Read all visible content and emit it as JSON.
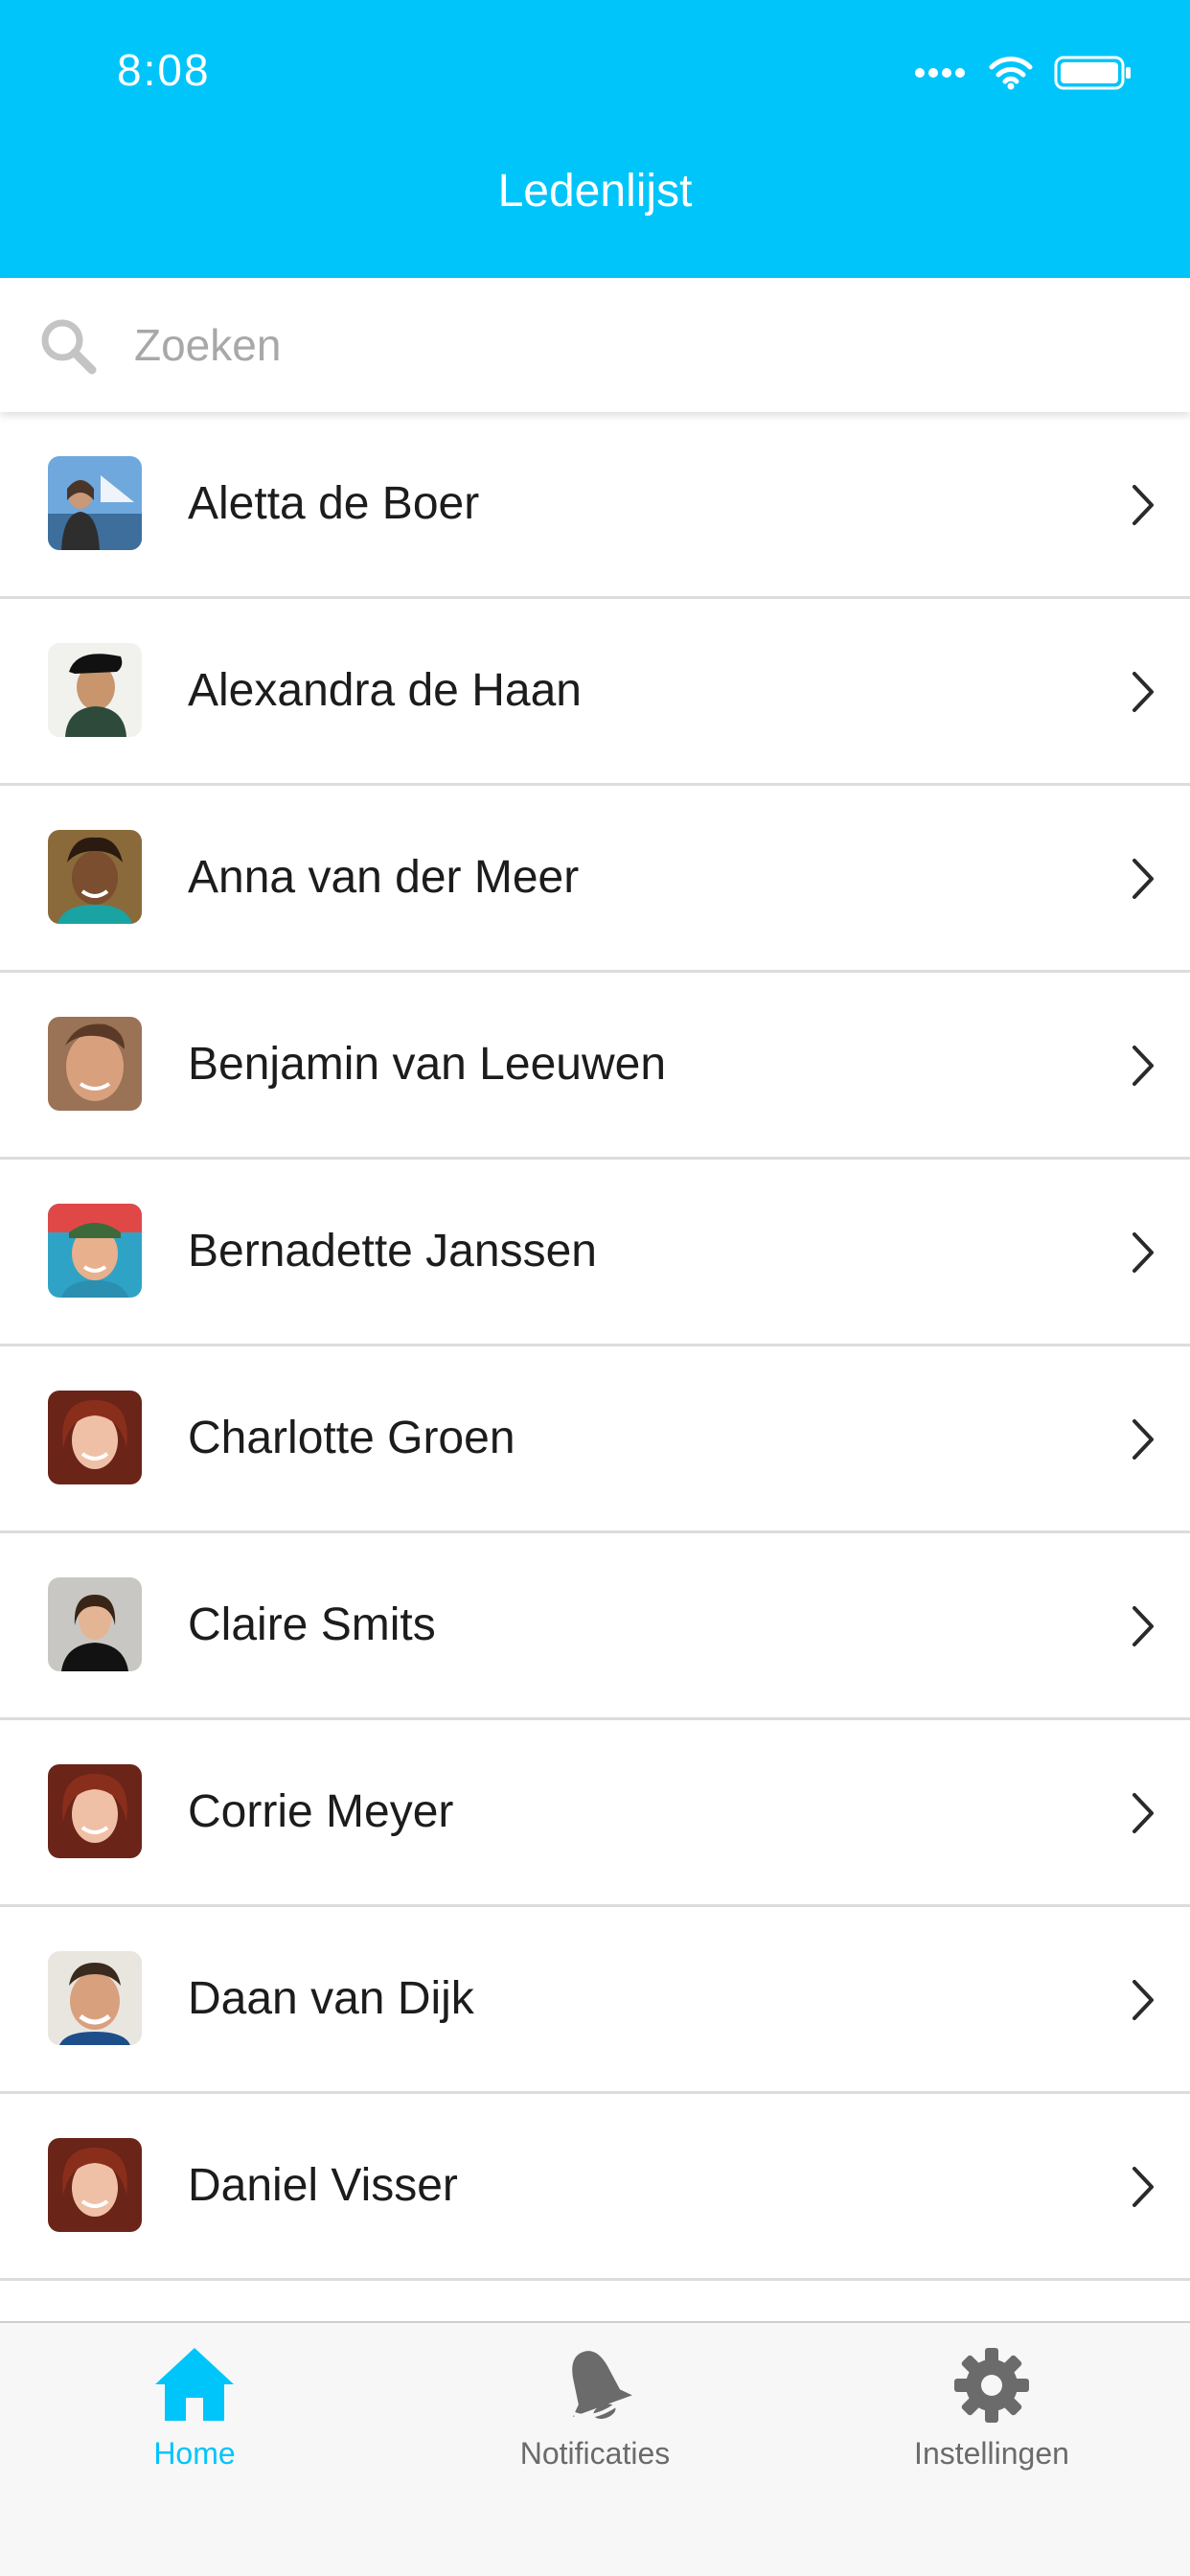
{
  "status_bar": {
    "time": "8:08"
  },
  "header": {
    "title": "Ledenlijst"
  },
  "search": {
    "placeholder": "Zoeken",
    "value": ""
  },
  "members": [
    {
      "name": "Aletta de Boer"
    },
    {
      "name": "Alexandra de Haan"
    },
    {
      "name": "Anna van der Meer"
    },
    {
      "name": "Benjamin van Leeuwen"
    },
    {
      "name": "Bernadette Janssen"
    },
    {
      "name": "Charlotte Groen"
    },
    {
      "name": "Claire Smits"
    },
    {
      "name": "Corrie Meyer"
    },
    {
      "name": "Daan van Dijk"
    },
    {
      "name": "Daniel Visser"
    }
  ],
  "tab_bar": {
    "tabs": [
      {
        "label": "Home",
        "icon": "home-icon",
        "active": true
      },
      {
        "label": "Notificaties",
        "icon": "bell-icon",
        "active": false
      },
      {
        "label": "Instellingen",
        "icon": "gear-icon",
        "active": false
      }
    ]
  },
  "colors": {
    "accent": "#00C5FA",
    "divider": "#dcdcdc",
    "tab_inactive": "#6b6b6b",
    "tab_bar_bg": "#f7f7f7"
  }
}
